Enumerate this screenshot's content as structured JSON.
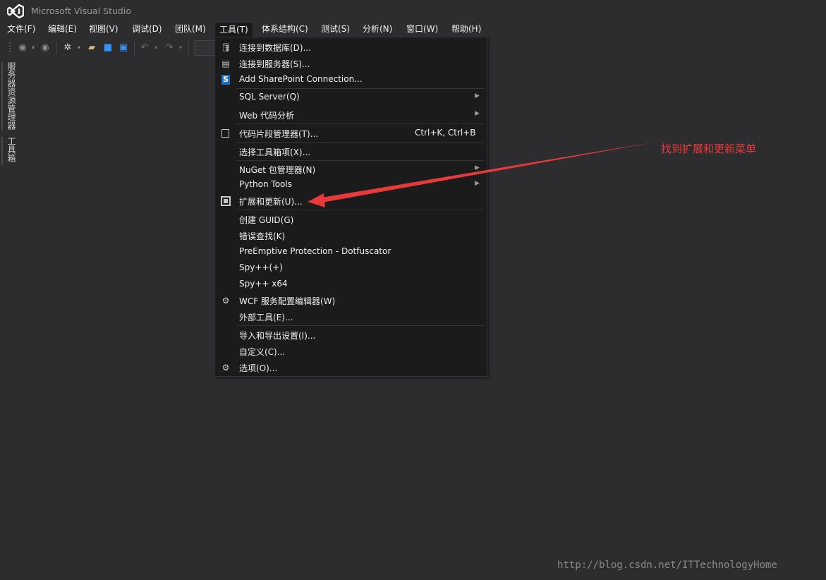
{
  "app": {
    "title": "Microsoft Visual Studio",
    "logo_icon": "visual-studio-logo-icon"
  },
  "menubar": [
    {
      "label": "文件(F)",
      "name": "menu-file"
    },
    {
      "label": "编辑(E)",
      "name": "menu-edit"
    },
    {
      "label": "视图(V)",
      "name": "menu-view"
    },
    {
      "label": "调试(D)",
      "name": "menu-debug"
    },
    {
      "label": "团队(M)",
      "name": "menu-team"
    },
    {
      "label": "工具(T)",
      "name": "menu-tools",
      "open": true
    },
    {
      "label": "体系结构(C)",
      "name": "menu-architecture"
    },
    {
      "label": "测试(S)",
      "name": "menu-test"
    },
    {
      "label": "分析(N)",
      "name": "menu-analyze"
    },
    {
      "label": "窗口(W)",
      "name": "menu-window"
    },
    {
      "label": "帮助(H)",
      "name": "menu-help"
    }
  ],
  "side_tabs": [
    "服务器资源管理器",
    "工具箱"
  ],
  "tools_menu": [
    {
      "label": "连接到数据库(D)...",
      "icon": "connect-database-icon",
      "glyph": "🛢"
    },
    {
      "label": "连接到服务器(S)...",
      "icon": "connect-server-icon",
      "glyph": "▤"
    },
    {
      "label": "Add SharePoint Connection...",
      "icon": "sharepoint-icon",
      "glyph": "S"
    },
    {
      "separator": true
    },
    {
      "label": "SQL Server(Q)",
      "submenu": true
    },
    {
      "label": "Web 代码分析",
      "submenu": true
    },
    {
      "separator": true
    },
    {
      "label": "代码片段管理器(T)...",
      "shortcut": "Ctrl+K, Ctrl+B",
      "icon": "code-snippet-icon"
    },
    {
      "separator": true
    },
    {
      "label": "选择工具箱项(X)..."
    },
    {
      "separator": true
    },
    {
      "label": "NuGet 包管理器(N)",
      "submenu": true
    },
    {
      "label": "Python Tools",
      "submenu": true
    },
    {
      "label": "扩展和更新(U)...",
      "icon": "extensions-icon"
    },
    {
      "separator": true
    },
    {
      "label": "创建 GUID(G)"
    },
    {
      "label": "错误查找(K)"
    },
    {
      "label": "PreEmptive Protection - Dotfuscator"
    },
    {
      "label": "Spy++(+)"
    },
    {
      "label": "Spy++ x64"
    },
    {
      "label": "WCF 服务配置编辑器(W)",
      "icon": "wcf-config-icon",
      "glyph": "⚙"
    },
    {
      "label": "外部工具(E)..."
    },
    {
      "separator": true
    },
    {
      "label": "导入和导出设置(I)..."
    },
    {
      "label": "自定义(C)..."
    },
    {
      "label": "选项(O)...",
      "icon": "options-gear-icon",
      "glyph": "⚙"
    }
  ],
  "annotation": {
    "text": "找到扩展和更新菜单",
    "color": "#e83a3a"
  },
  "watermark": "http://blog.csdn.net/ITTechnologyHome",
  "colors": {
    "background": "#2d2d30",
    "menu_background": "#1b1b1c",
    "border": "#333337",
    "text": "#f1f1f1"
  }
}
